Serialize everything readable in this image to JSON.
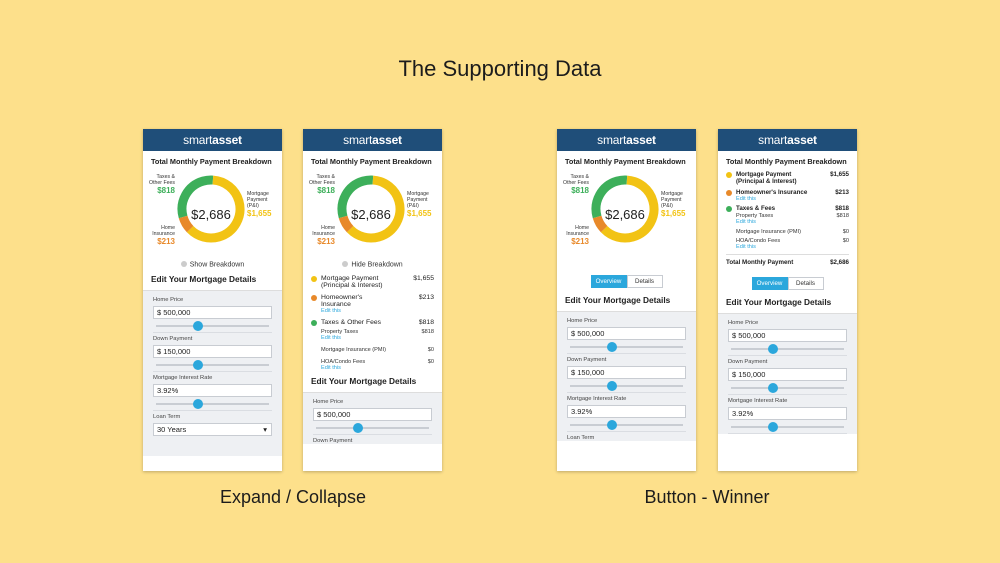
{
  "title": "The Supporting Data",
  "captions": {
    "left": "Expand / Collapse",
    "right": "Button - Winner"
  },
  "colors": {
    "taxes": "#3daf5a",
    "insurance": "#e8892a",
    "mortgage": "#f2c314",
    "header": "#1f4e79",
    "accent": "#2ba7dc"
  },
  "logo": {
    "smart": "smart",
    "asset": "asset"
  },
  "breakdown": {
    "title": "Total Monthly Payment Breakdown",
    "total": "$2,686",
    "taxes_label_1": "Taxes &",
    "taxes_label_2": "Other Fees",
    "taxes_value": "$818",
    "mortgage_label_1": "Mortgage",
    "mortgage_label_2": "Payment",
    "mortgage_label_3": "(P&I)",
    "mortgage_value": "$1,655",
    "insurance_label_1": "Home",
    "insurance_label_2": "Insurance",
    "insurance_value": "$213",
    "show_label": "Show Breakdown",
    "hide_label": "Hide Breakdown",
    "total_row_label": "Total Monthly Payment",
    "total_row_value": "$2,686"
  },
  "legend": {
    "mortgage": "Mortgage Payment",
    "mortgage_sub": "(Principal & Interest)",
    "mortgage_value": "$1,655",
    "insurance_a": "Homeowner's",
    "insurance_b": "Insurance",
    "insurance_full": "Homeowner's Insurance",
    "insurance_value": "$213",
    "edit_this": "Edit this",
    "taxes": "Taxes & Other Fees",
    "taxes_short": "Taxes & Fees",
    "taxes_value": "$818",
    "property_taxes": "Property Taxes",
    "property_taxes_value": "$818",
    "pmi": "Mortgage Insurance (PMI)",
    "pmi_value": "$0",
    "hoa": "HOA/Condo Fees",
    "hoa_value": "$0"
  },
  "tabs": {
    "overview": "Overview",
    "details": "Details"
  },
  "form": {
    "heading": "Edit Your Mortgage Details",
    "home_price_label": "Home Price",
    "home_price": "$ 500,000",
    "down_payment_label": "Down Payment",
    "down_payment": "$ 150,000",
    "rate_label": "Mortgage Interest Rate",
    "rate": "3.92%",
    "loan_term_label": "Loan Term",
    "loan_term": "30 Years",
    "dropdown_arrow": "▾"
  },
  "sliders": {
    "home_price": 0.38,
    "down_payment": 0.38,
    "rate": 0.38
  },
  "chart_data": {
    "type": "pie",
    "title": "Total Monthly Payment Breakdown",
    "categories": [
      "Mortgage Payment (P&I)",
      "Taxes & Other Fees",
      "Home Insurance"
    ],
    "values": [
      1655,
      818,
      213
    ],
    "colors": [
      "#f2c314",
      "#3daf5a",
      "#e8892a"
    ],
    "center_label": "$2,686"
  }
}
